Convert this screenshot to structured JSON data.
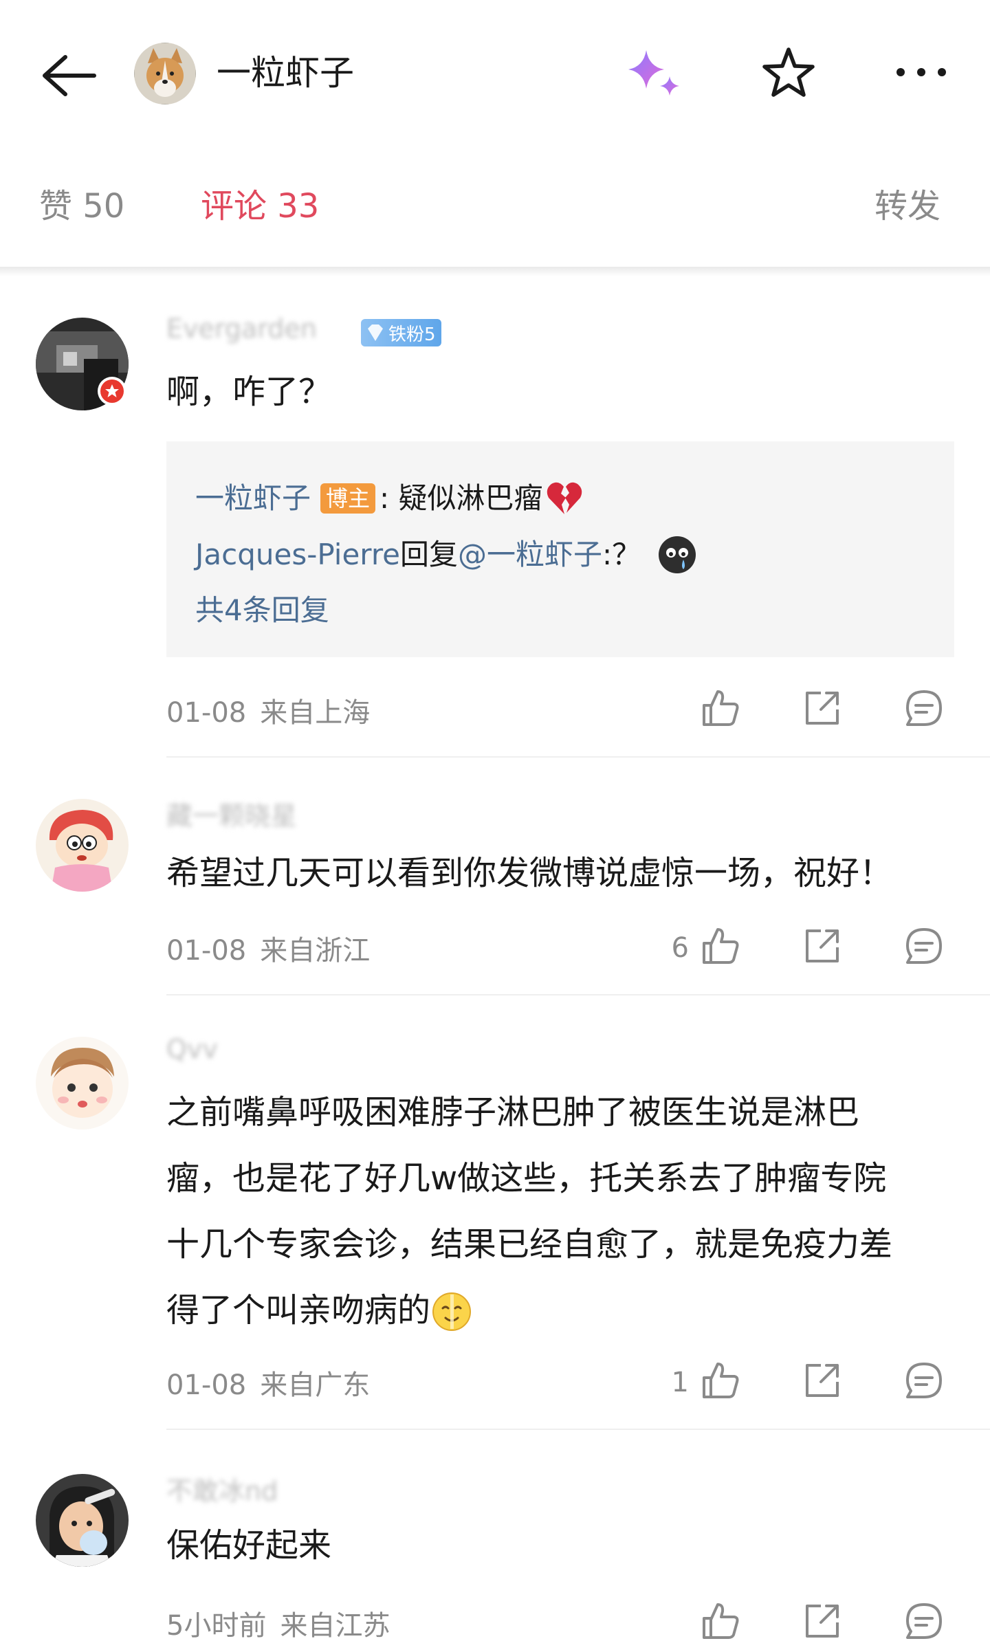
{
  "header": {
    "title": "一粒虾子",
    "icons": [
      "back-arrow-icon",
      "avatar-corgi",
      "sparkle-ai-icon",
      "star-icon",
      "more-icon"
    ]
  },
  "tabs": {
    "likes": "赞 50",
    "comments": "评论 33",
    "reposts": "转发"
  },
  "colors": {
    "accent": "#e0495d",
    "link": "#4b6d93",
    "host_badge": "#f39a3d",
    "fan_badge": "#6aaeee"
  },
  "comments": [
    {
      "username": "Evergarden",
      "fan_badge": "铁粉5",
      "text": "啊，咋了？",
      "replies": {
        "line1_user": "一粒虾子",
        "line1_badge": "博主",
        "line1_text": ": 疑似淋巴瘤",
        "line2_user": "Jacques-Pierre",
        "line2_mid": " 回复",
        "line2_at": "@一粒虾子",
        "line2_text": ":？",
        "more": "共4条回复"
      },
      "date": "01-08",
      "location": "来自上海",
      "likes": ""
    },
    {
      "username": "藏一颗晓星",
      "text": "希望过几天可以看到你发微博说虚惊一场，祝好！",
      "date": "01-08",
      "location": "来自浙江",
      "likes": "6"
    },
    {
      "username": "Qvv",
      "text_lines": [
        "之前嘴鼻呼吸困难脖子淋巴肿了被医生说是淋巴",
        "瘤，也是花了好几w做这些，托关系去了肿瘤专院",
        "十几个专家会诊，结果已经自愈了，就是免疫力差",
        "得了个叫亲吻病的"
      ],
      "date": "01-08",
      "location": "来自广东",
      "likes": "1"
    },
    {
      "username": "不敢冰nd",
      "text": "保佑好起来",
      "date": "5小时前",
      "location": "来自江苏",
      "likes": ""
    }
  ]
}
